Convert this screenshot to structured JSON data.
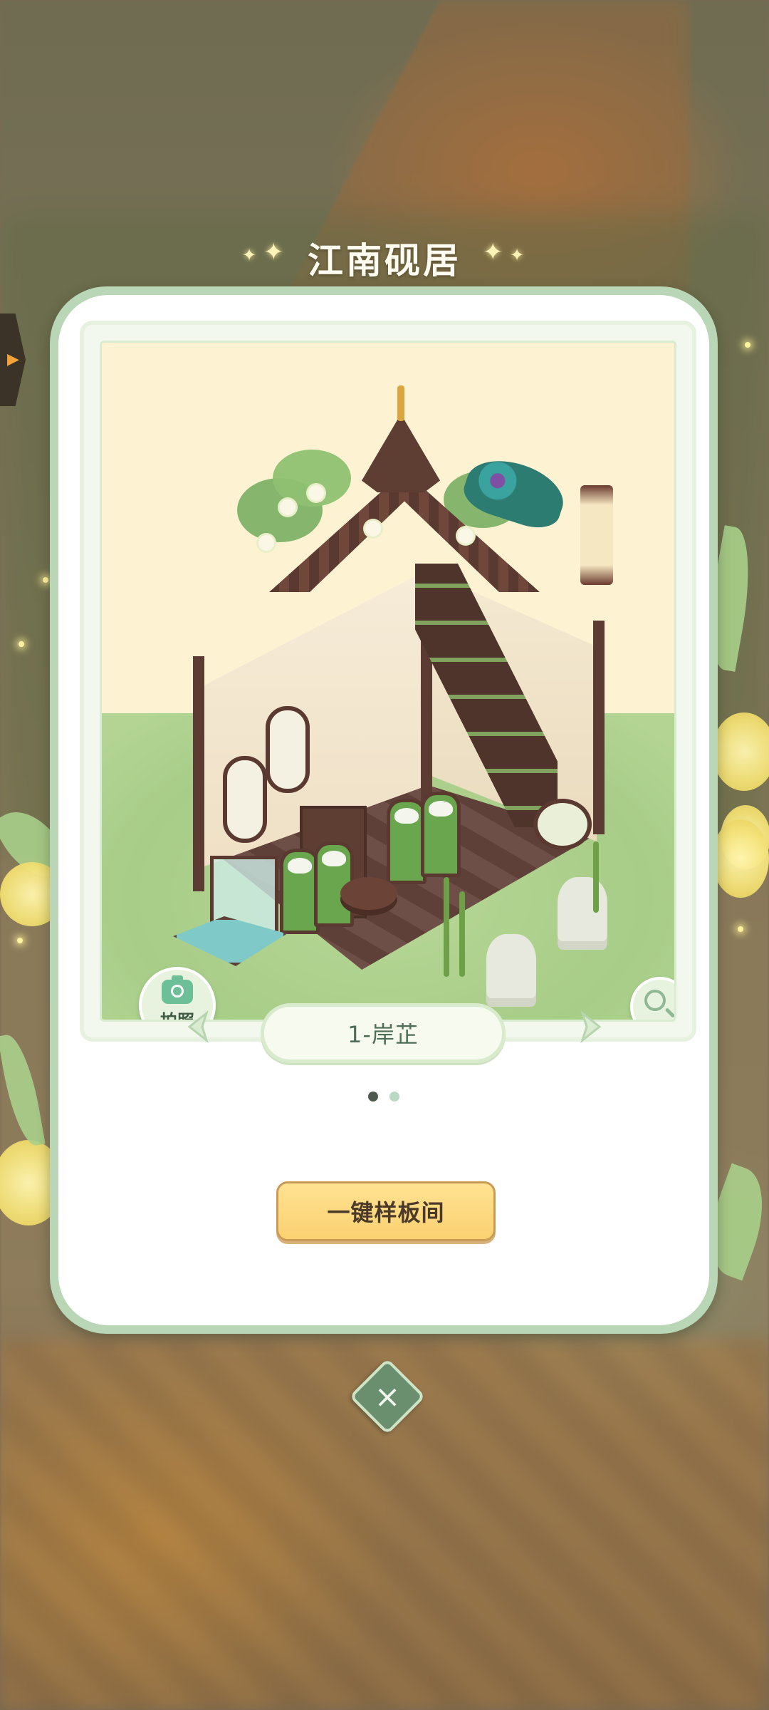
{
  "title": "江南砚居",
  "photo_button": {
    "label": "拍照",
    "icon": "camera-icon"
  },
  "zoom_button": {
    "icon": "zoom-list-icon"
  },
  "arrows": {
    "prev": "chevron-left-icon",
    "next": "chevron-right-icon"
  },
  "layout_name": "1-岸芷",
  "pagination": {
    "total": 2,
    "current": 1
  },
  "apply_button": {
    "label": "一键样板间"
  },
  "close_button": {
    "icon": "close-icon"
  },
  "colors": {
    "card_border": "#b9d6b6",
    "accent_yellow": "#fbd172",
    "text_green": "#4d6d56",
    "dot_active": "#4c5a4e",
    "dot_inactive": "#b9d9c4"
  }
}
